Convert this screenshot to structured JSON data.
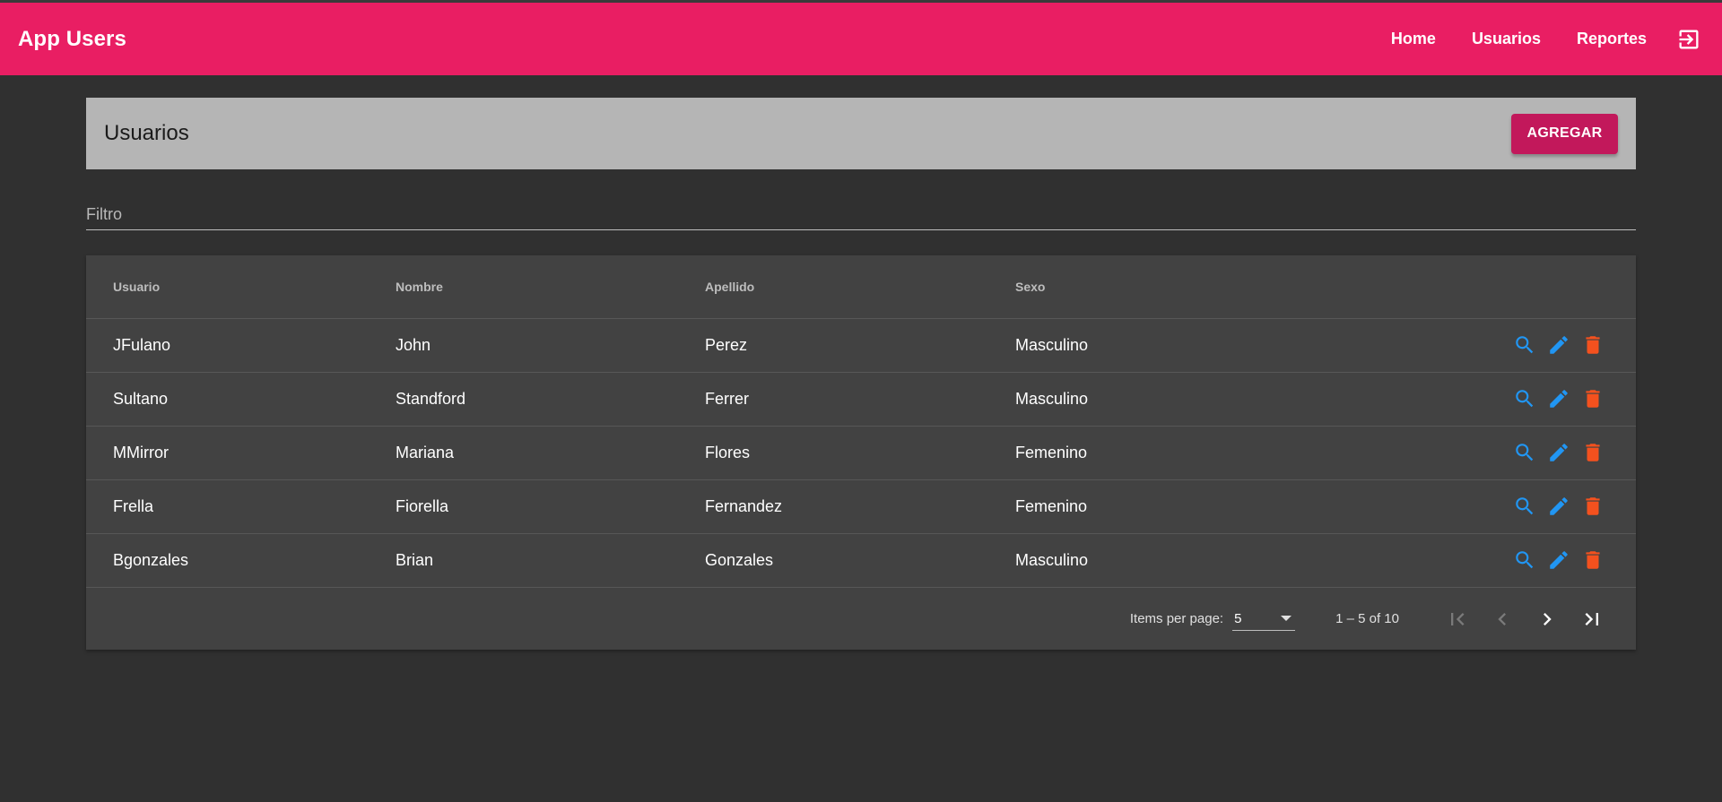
{
  "app": {
    "title": "App Users"
  },
  "nav": {
    "home": "Home",
    "usuarios": "Usuarios",
    "reportes": "Reportes",
    "logout_icon": "logout-icon"
  },
  "header": {
    "title": "Usuarios",
    "add_button": "AGREGAR"
  },
  "filter": {
    "placeholder": "Filtro",
    "value": ""
  },
  "table": {
    "columns": [
      "Usuario",
      "Nombre",
      "Apellido",
      "Sexo"
    ],
    "rows": [
      [
        "JFulano",
        "John",
        "Perez",
        "Masculino"
      ],
      [
        "Sultano",
        "Standford",
        "Ferrer",
        "Masculino"
      ],
      [
        "MMirror",
        "Mariana",
        "Flores",
        "Femenino"
      ],
      [
        "Frella",
        "Fiorella",
        "Fernandez",
        "Femenino"
      ],
      [
        "Bgonzales",
        "Brian",
        "Gonzales",
        "Masculino"
      ]
    ],
    "row_actions": [
      "search-icon",
      "edit-icon",
      "delete-icon"
    ]
  },
  "paginator": {
    "items_per_page_label": "Items per page:",
    "page_size": "5",
    "range_label": "1 – 5 of 10"
  },
  "colors": {
    "toolbar": "#e91e63",
    "accent_button": "#c2185b",
    "background": "#303030",
    "card": "#424242",
    "header_card": "#b5b5b5",
    "action_blue": "#2196f3",
    "action_red": "#f4511e"
  }
}
